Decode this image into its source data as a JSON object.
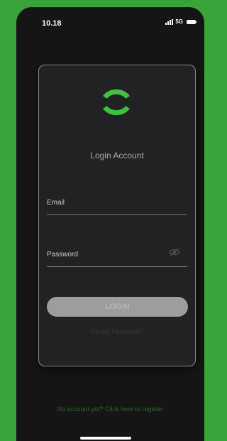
{
  "status_bar": {
    "time": "10.18",
    "network": "5G"
  },
  "login_card": {
    "title": "Login Account",
    "email_label": "Email",
    "email_value": "",
    "password_label": "Password",
    "password_value": "",
    "login_button": "LOGIN",
    "forgot_password": "Forgot Password?"
  },
  "register_link": "No account yet? Click here to register",
  "colors": {
    "background": "#3aa33a",
    "screen": "#151515",
    "card": "#222225",
    "accent": "#3cc43c",
    "button": "#9d9da0"
  },
  "icons": {
    "logo": "app-logo-icon",
    "password_toggle": "eye-off-icon",
    "signal": "signal-bars-icon",
    "battery": "battery-icon"
  }
}
